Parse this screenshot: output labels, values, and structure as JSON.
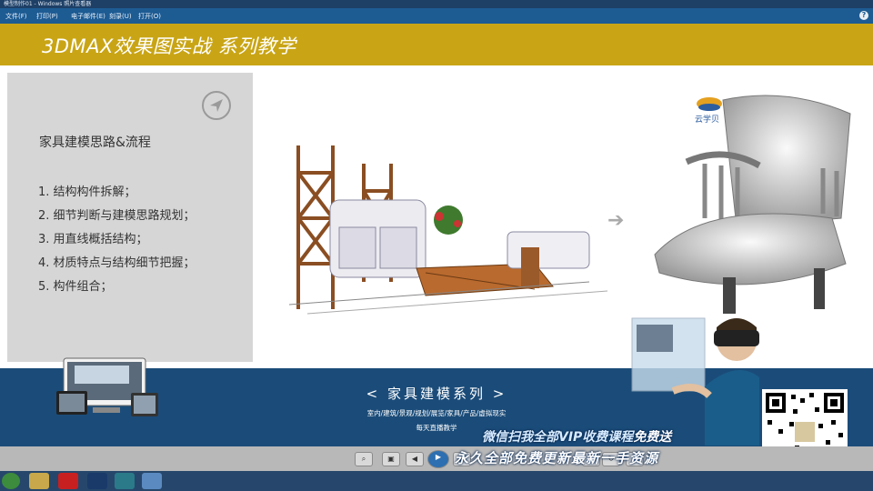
{
  "window": {
    "title": "模型制作01 - Windows 照片查看器"
  },
  "menu": {
    "items": [
      "文件(F)",
      "打印(P)",
      "电子邮件(E)",
      "刻录(U)",
      "打开(O)"
    ],
    "help": "?"
  },
  "slide": {
    "header_title": "3DMAX效果图实战  系列教学",
    "panel_title": "家具建模思路&流程",
    "steps": [
      "1.  结构构件拆解；",
      "2.  细节判断与建模思路规划；",
      "3.  用直线概括结构；",
      "4.  材质特点与结构细节把握；",
      "5.  构件组合；"
    ],
    "arrow": "➔",
    "logo_text": "云学贝",
    "band_title": "<  家具建模系列  >",
    "band_subtitle": "室内/建筑/景观/规划/展览/家具/产品/虚拟现实",
    "band_subtitle2": "每天直播教学"
  },
  "promo": {
    "line1_prefix": "微信扫我全部VIP收费课程",
    "line1_suffix": "免费送",
    "line2": "永久全部免费更新最新一手资源"
  },
  "colors": {
    "header_gold": "#c9a516",
    "band_blue": "#1b4c79",
    "menu_blue": "#1d5b93",
    "taskbar": "#26476b"
  }
}
